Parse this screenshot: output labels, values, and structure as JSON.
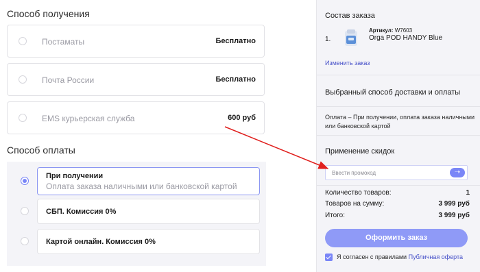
{
  "delivery": {
    "title": "Способ получения",
    "options": [
      {
        "label": "Постаматы",
        "price": "Бесплатно"
      },
      {
        "label": "Почта России",
        "price": "Бесплатно"
      },
      {
        "label": "EMS курьерская служба",
        "price": "600 руб"
      }
    ]
  },
  "payment": {
    "title": "Способ оплаты",
    "options": [
      {
        "label": "При получении",
        "sublabel": "Оплата заказа наличными или банковской картой",
        "selected": true
      },
      {
        "label": "СБП. Комиссия 0%",
        "selected": false
      },
      {
        "label": "Картой онлайн. Комиссия 0%",
        "selected": false
      }
    ]
  },
  "order": {
    "title": "Состав заказа",
    "item_number": "1.",
    "sku_label": "Артикул:",
    "sku": "W7603",
    "product_name": "Orga POD HANDY Blue",
    "change_link": "Изменить заказ",
    "chosen_title": "Выбранный способ доставки и оплаты",
    "chosen_desc": "Оплата – При получении, оплата заказа наличными или банковской картой",
    "discount_title": "Применение скидок",
    "promo_placeholder": "Ввести промокод",
    "promo_button_icon": "arrow-right-icon",
    "summary": [
      {
        "label": "Количество товаров:",
        "value": "1"
      },
      {
        "label": "Товаров на сумму:",
        "value": "3 999 руб"
      },
      {
        "label": "Итого:",
        "value": "3 999 руб"
      }
    ],
    "submit_label": "Оформить заказ",
    "agree_text": "Я согласен с правилами",
    "agree_link": "Публичная оферта",
    "agree_checked": true
  },
  "colors": {
    "accent": "#7a86f7",
    "annotation_arrow": "#e0201e",
    "link": "#4650c8"
  }
}
